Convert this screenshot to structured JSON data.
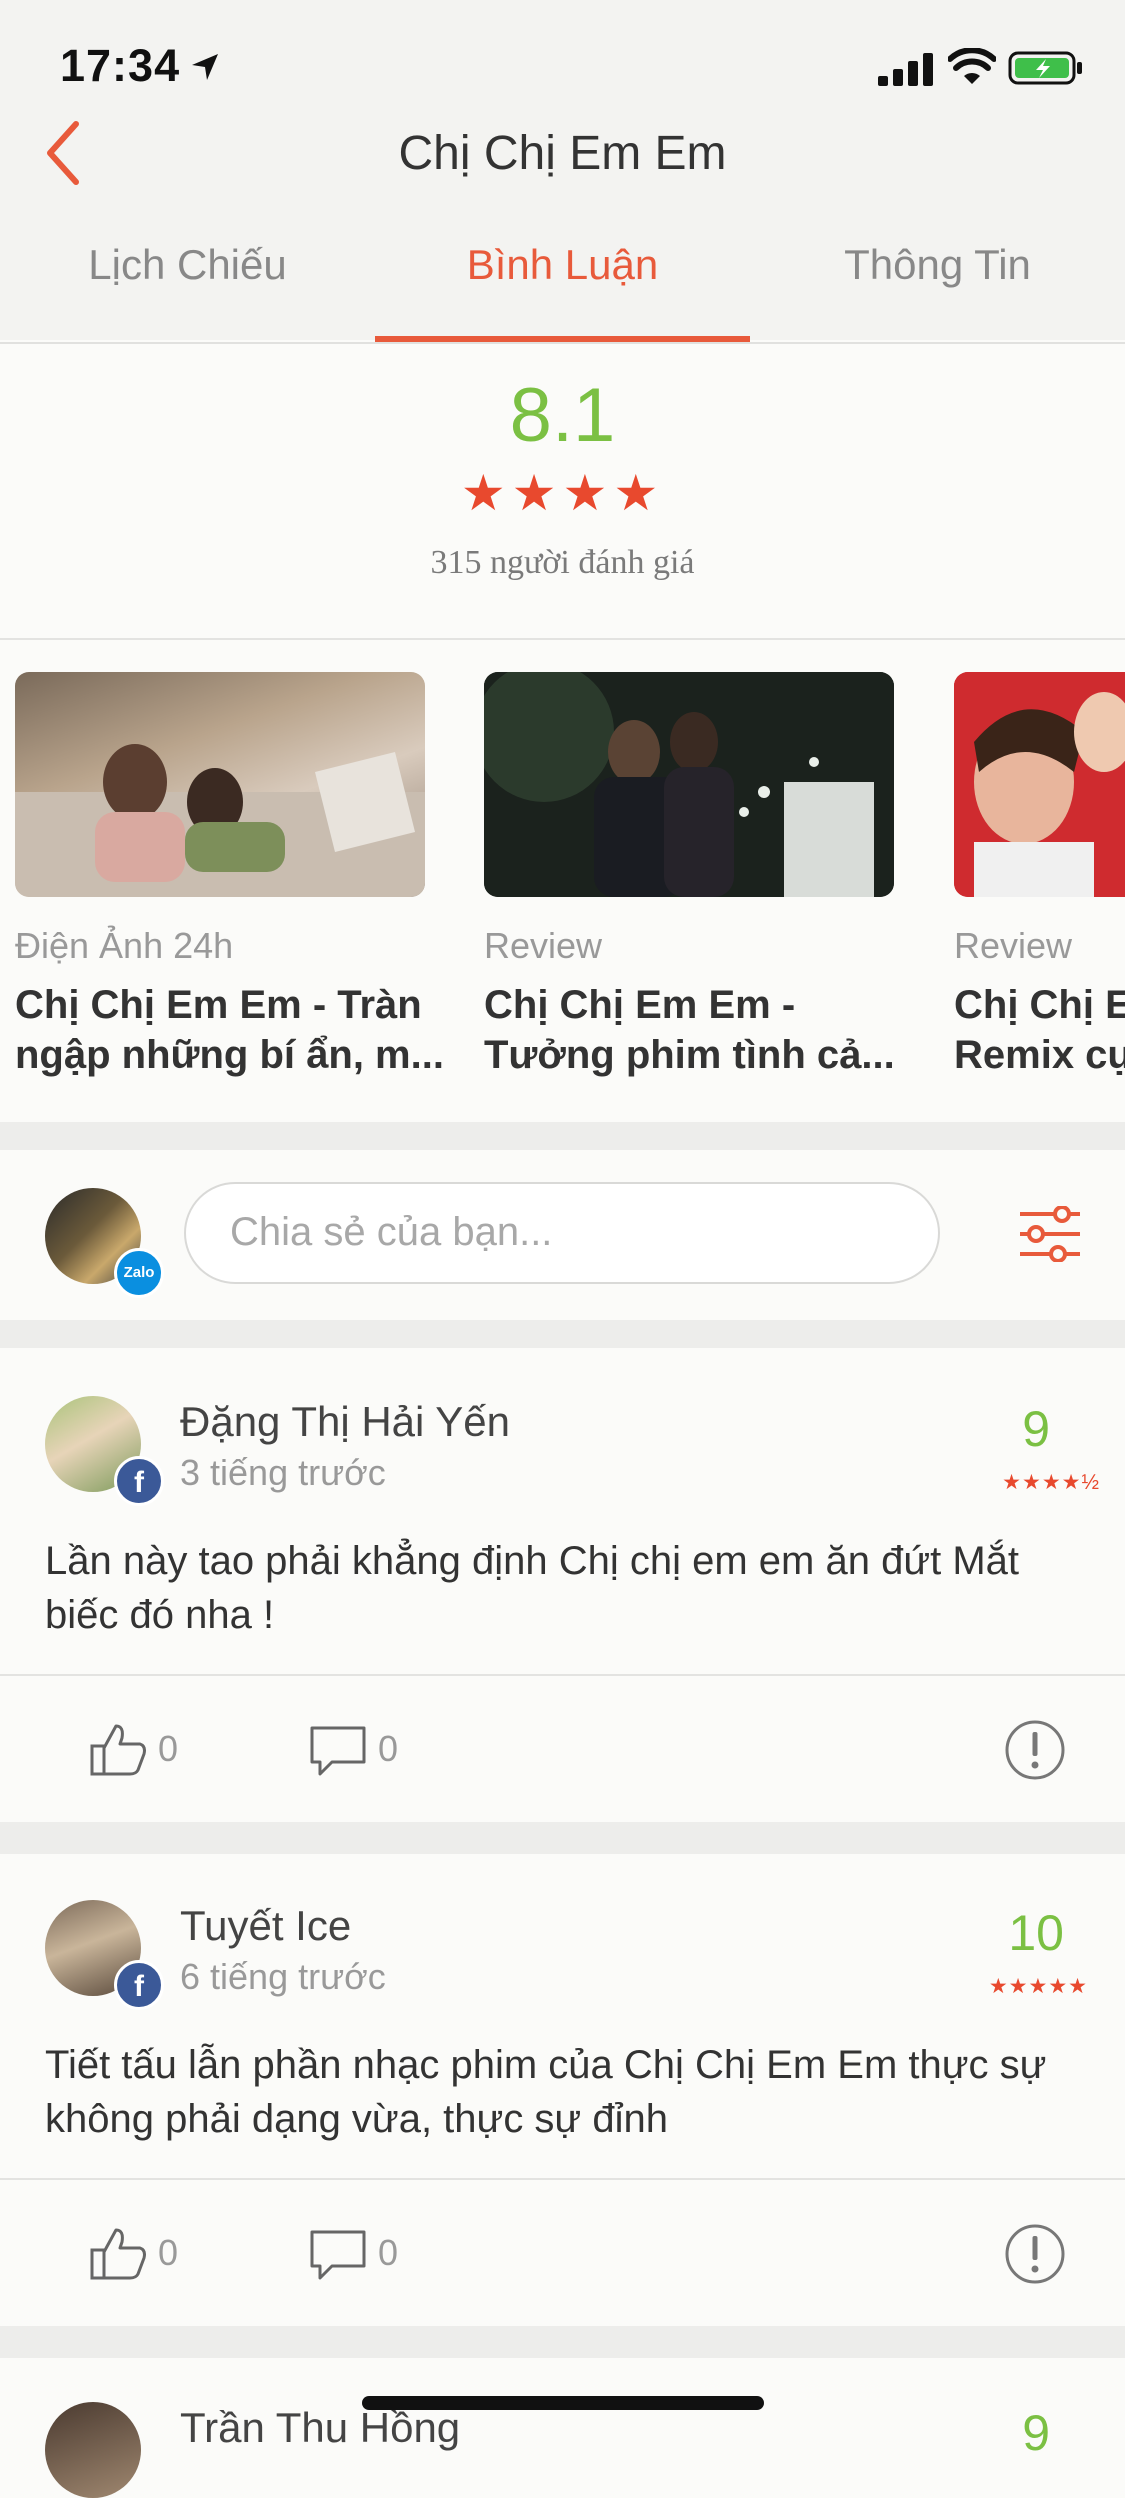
{
  "status": {
    "time": "17:34"
  },
  "header": {
    "title": "Chị Chị Em Em",
    "tabs": [
      {
        "label": "Lịch Chiếu"
      },
      {
        "label": "Bình Luận"
      },
      {
        "label": "Thông Tin"
      }
    ],
    "active_tab": 1
  },
  "rating": {
    "score": "8.1",
    "stars": "★★★★",
    "count": "315 người đánh giá"
  },
  "news": [
    {
      "source": "Điện Ảnh 24h",
      "title_lines": [
        "Chị Chị Em Em - Tràn",
        "ngập những bí ẩn, m..."
      ]
    },
    {
      "source": "Review",
      "title_lines": [
        "Chị Chị Em Em -",
        "Tưởng phim tình cả..."
      ]
    },
    {
      "source": "Review",
      "title_lines": [
        "Chị Chị Em Em -",
        "Remix cự..."
      ]
    }
  ],
  "composer": {
    "placeholder": "Chia sẻ của bạn...",
    "badge": "Zalo"
  },
  "comments": [
    {
      "name": "Đặng Thị Hải Yến",
      "time": "3 tiếng trước",
      "score": "9",
      "stars": "★★★★½",
      "body_lines": [
        "Lần này tao phải khẳng định Chị chị em em ăn đứt Mắt",
        "biếc đó nha !"
      ],
      "likes": "0",
      "replies": "0"
    },
    {
      "name": "Tuyết Ice",
      "time": "6 tiếng trước",
      "score": "10",
      "stars": "★★★★★",
      "body_lines": [
        "Tiết tấu lẫn phần nhạc phim của Chị Chị Em Em thực sự",
        "không phải dạng vừa, thực sự đỉnh"
      ],
      "likes": "0",
      "replies": "0"
    },
    {
      "name": "Trần Thu Hồng",
      "score": "9"
    }
  ],
  "colors": {
    "accent": "#e85a3b",
    "score_green": "#7bc043",
    "facebook": "#3b5998",
    "zalo": "#0a8fe0"
  },
  "icons": [
    "back-chevron-icon",
    "location-arrow-icon",
    "signal-icon",
    "wifi-icon",
    "battery-icon",
    "filter-sliders-icon",
    "facebook-icon",
    "like-icon",
    "comment-icon",
    "report-icon"
  ]
}
